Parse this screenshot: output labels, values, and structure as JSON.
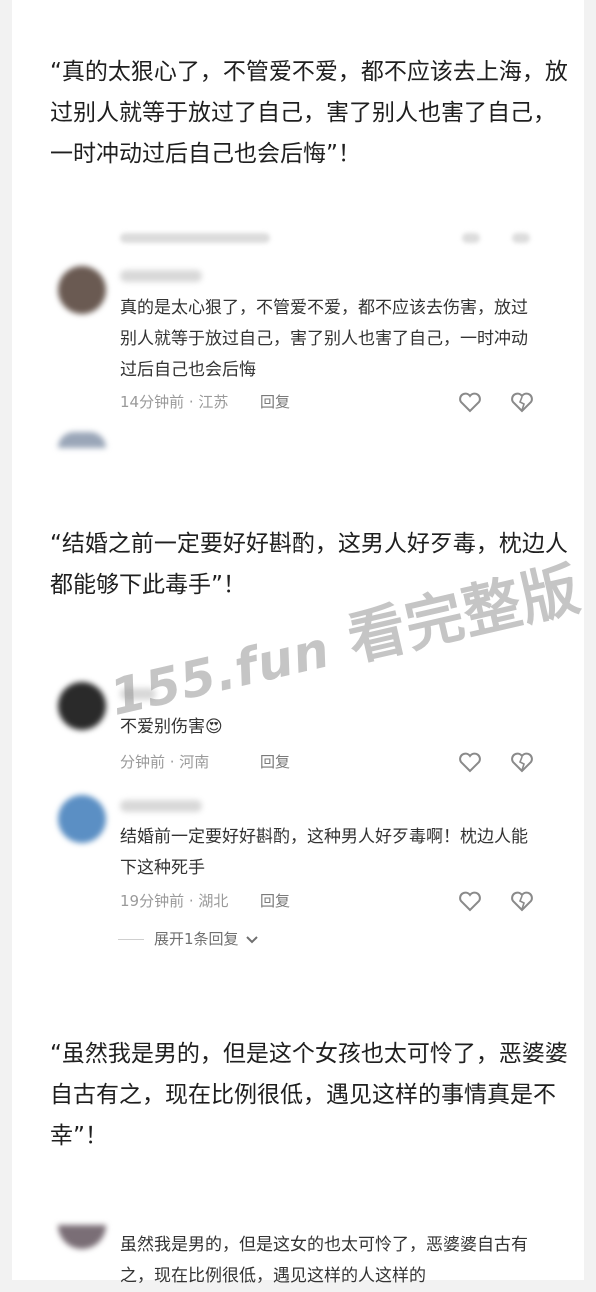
{
  "quotes": {
    "q1": "“真的太狠心了，不管爱不爱，都不应该去上海，放过别人就等于放过了自己，害了别人也害了自己，一时冲动过后自己也会后悔”！",
    "q2": "“结婚之前一定要好好斟酌，这男人好歹毒，枕边人都能够下此毒手”！",
    "q3": "“虽然我是男的，但是这个女孩也太可怜了，恶婆婆自古有之，现在比例很低，遇见这样的事情真是不幸”！"
  },
  "comments": [
    {
      "text": "真的是太心狠了，不管爱不爱，都不应该去伤害，放过别人就等于放过自己，害了别人也害了自己，一时冲动过后自己也会后悔",
      "meta": "14分钟前 · 江苏",
      "reply": "回复"
    },
    {
      "text": "不爱别伤害😍",
      "meta": "分钟前 · 河南",
      "reply": "回复"
    },
    {
      "text": "结婚前一定要好好斟酌，这种男人好歹毒啊！枕边人能下这种死手",
      "meta": "19分钟前 · 湖北",
      "reply": "回复"
    },
    {
      "text": "虽然我是男的，但是这女的也太可怜了，恶婆婆自古有之，现在比例很低，遇见这样的人这样的"
    }
  ],
  "expand_replies": "展开1条回复",
  "watermark": {
    "domain": "155.fun",
    "text": "看完整版"
  },
  "colors": {
    "background": "#f2f2f2",
    "card": "#ffffff",
    "text": "#1f1f1f",
    "meta": "#9a9a9a"
  }
}
